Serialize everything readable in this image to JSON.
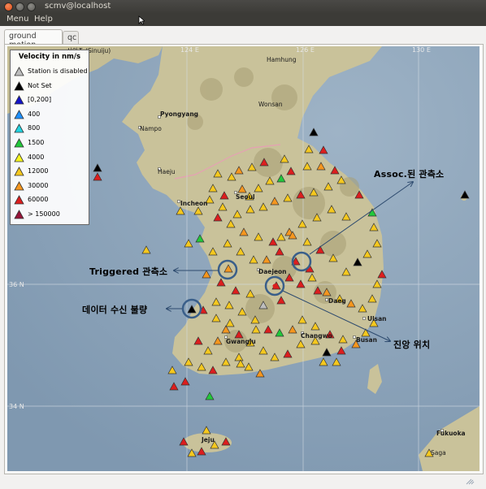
{
  "window": {
    "title": "scmv@localhost"
  },
  "menu": {
    "items": [
      "Menu",
      "Help"
    ]
  },
  "tabs": [
    "ground motion",
    "qc"
  ],
  "legend": {
    "title": "Velocity in nm/s",
    "items": [
      {
        "label": "Station is disabled",
        "color": "#bdbdbd"
      },
      {
        "label": "Not Set",
        "color": "#000000"
      },
      {
        "label": "[0,200]",
        "color": "#1414c8"
      },
      {
        "label": "400",
        "color": "#1e90ff"
      },
      {
        "label": "800",
        "color": "#22d3e0"
      },
      {
        "label": "1500",
        "color": "#22c83a"
      },
      {
        "label": "4000",
        "color": "#f5f51e"
      },
      {
        "label": "12000",
        "color": "#f5c81e"
      },
      {
        "label": "30000",
        "color": "#f5961e"
      },
      {
        "label": "60000",
        "color": "#dc1e1e"
      },
      {
        "label": "> 150000",
        "color": "#961438"
      }
    ]
  },
  "grid_labels": {
    "top_left": "124 E",
    "top_mid": "126 E",
    "top_right": "130 E",
    "lat_36": "36 N",
    "lat_34": "34 N"
  },
  "cities": {
    "sinuiju": "신의주 (Sinuiju)",
    "hamhung": "Hamhung",
    "pyongyang": "Pyongyang",
    "wonsan": "Wonsan",
    "nampo": "Nampo",
    "haeju": "Haeju",
    "incheon": "Incheon",
    "seoul": "Seoul",
    "daejeon": "Daejeon",
    "daegu": "Daeg",
    "ulsan": "Ulsan",
    "gwangju": "Gwangju",
    "changwon": "Changwo",
    "busan": "Busan",
    "jeju": "Jeju",
    "fukuoka": "Fukuoka",
    "saga": "Saga"
  },
  "annotations": {
    "assoc": "Assoc.된 관측소",
    "triggered": "Triggered 관측소",
    "bad_data": "데이터 수신 불량",
    "epicenter": "진앙 위치"
  },
  "colors": {
    "annotation_circle": "#3a5f8a",
    "arrow": "#2d4a6e",
    "sea": "#8fa6bb",
    "land": "#c9c29a"
  }
}
